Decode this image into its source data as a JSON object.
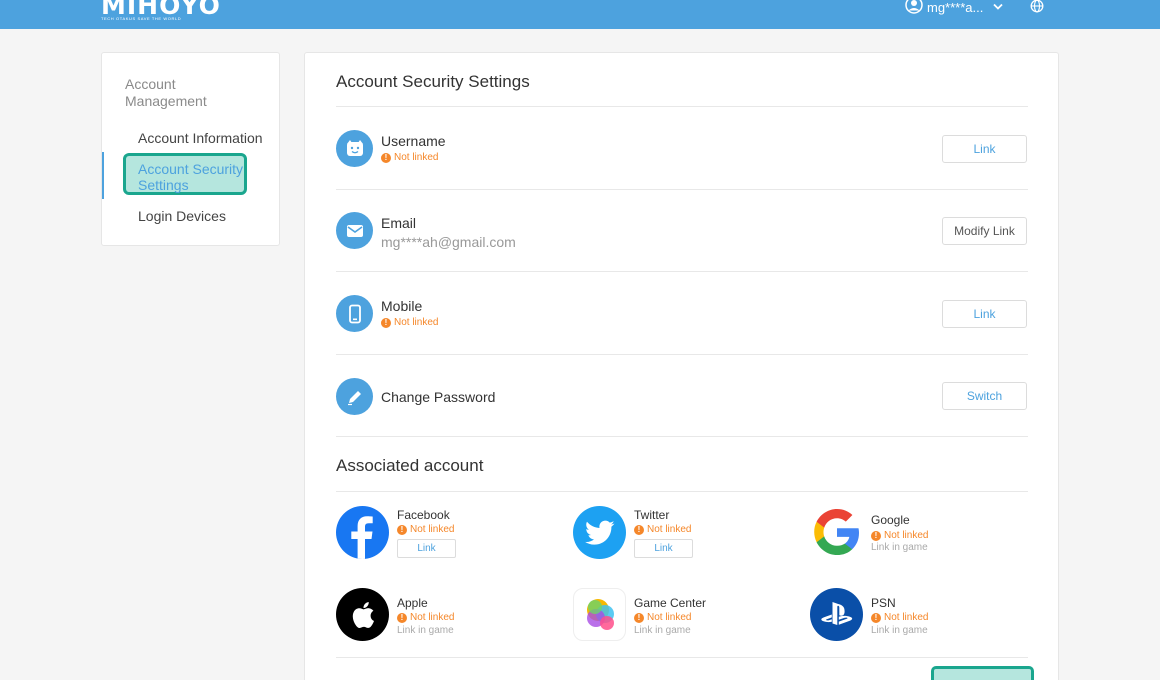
{
  "header": {
    "logo": "MIHOYO",
    "tagline": "TECH OTAKUS SAVE THE WORLD",
    "username": "mg****a...",
    "colors": {
      "bar": "#4da2de"
    }
  },
  "sidebar": {
    "heading": "Account Management",
    "items": [
      {
        "label": "Account Information",
        "active": false
      },
      {
        "label": "Account Security Settings",
        "active": true
      },
      {
        "label": "Login Devices",
        "active": false
      }
    ]
  },
  "security": {
    "title": "Account Security Settings",
    "rows": [
      {
        "icon": "face-icon",
        "title": "Username",
        "status": "Not linked",
        "button": "Link"
      },
      {
        "icon": "mail-icon",
        "title": "Email",
        "value": "mg****ah@gmail.com",
        "button": "Modify Link"
      },
      {
        "icon": "phone-icon",
        "title": "Mobile",
        "status": "Not linked",
        "button": "Link"
      },
      {
        "icon": "pencil-icon",
        "title": "Change Password",
        "button": "Switch"
      }
    ]
  },
  "associated": {
    "title": "Associated account",
    "accounts": [
      {
        "icon": "facebook-icon",
        "name": "Facebook",
        "status": "Not linked",
        "button": "Link"
      },
      {
        "icon": "twitter-icon",
        "name": "Twitter",
        "status": "Not linked",
        "button": "Link"
      },
      {
        "icon": "google-icon",
        "name": "Google",
        "status": "Not linked",
        "note": "Link in game"
      },
      {
        "icon": "apple-icon",
        "name": "Apple",
        "status": "Not linked",
        "note": "Link in game"
      },
      {
        "icon": "game-center-icon",
        "name": "Game Center",
        "status": "Not linked",
        "note": "Link in game"
      },
      {
        "icon": "psn-icon",
        "name": "PSN",
        "status": "Not linked",
        "note": "Link in game"
      }
    ]
  }
}
